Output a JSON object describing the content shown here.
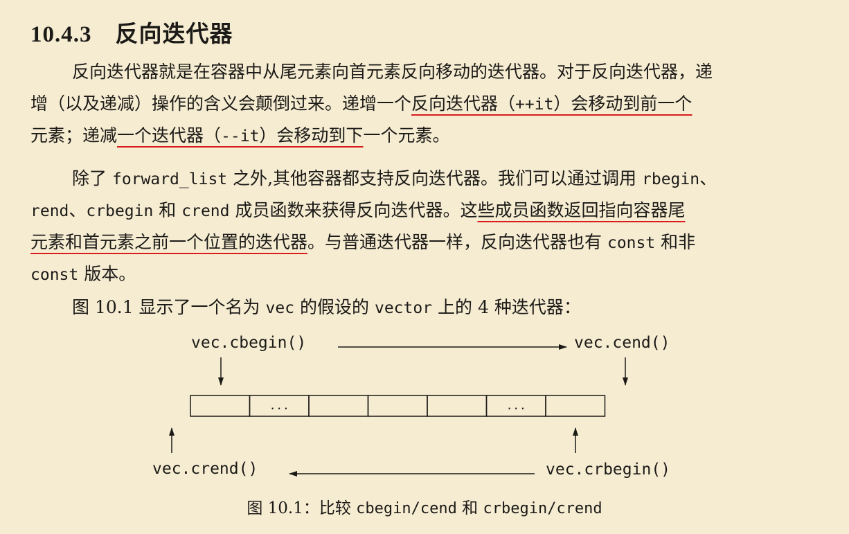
{
  "section": {
    "number": "10.4.3",
    "title": "反向迭代器"
  },
  "para1": {
    "l1": "反向迭代器就是在容器中从尾元素向首元素反向移动的迭代器。对于反向迭代器，递",
    "l2a": "增（以及递减）操作的含义会颠倒过来。递增一个",
    "l2b": "反向迭代器（",
    "l2c": "++it",
    "l2d": "）会移动到前一个",
    "l3a": "元素；递减",
    "l3b": "一个迭代器（",
    "l3c": "--it",
    "l3d": "）会移动到下",
    "l3e": "一个元素。"
  },
  "para2": {
    "l1a": "除了",
    "l1b": "forward_list",
    "l1c": "之外,其他容器都支持反向迭代器。我们可以通过调用",
    "l1d": "rbegin",
    "l1e": "、",
    "l2a": "rend",
    "l2b": "、",
    "l2c": "crbegin",
    "l2d": " 和 ",
    "l2e": "crend",
    "l2f": " 成员函数来获得反向迭代器。这",
    "l2g": "些成员函数返回指向容器尾",
    "l3a": "元素和首元素之前一个位置的迭代器",
    "l3b": "。与普通迭代器一样，反向迭代器也有",
    "l3c": "const",
    "l3d": " 和非",
    "l4a": "const",
    "l4b": " 版本。"
  },
  "para3": {
    "a": "图 10.1 显示了一个名为",
    "b": "vec",
    "c": "的假设的",
    "d": "vector",
    "e": "上的 4 种迭代器："
  },
  "figure": {
    "cbegin": "vec.cbegin()",
    "cend": "vec.cend()",
    "crend": "vec.crend()",
    "crbegin": "vec.crbegin()",
    "cell_ellipsis": "...",
    "cell_count": 7,
    "ellipsis_cells": [
      1,
      5
    ]
  },
  "caption": {
    "prefix": "图 10.1：比较",
    "code1": "cbegin/cend",
    "mid": "和",
    "code2": "crbegin/crend"
  },
  "colors": {
    "background": "#f5ecd2",
    "text": "#1c1a17",
    "underline": "#d91c1c"
  }
}
